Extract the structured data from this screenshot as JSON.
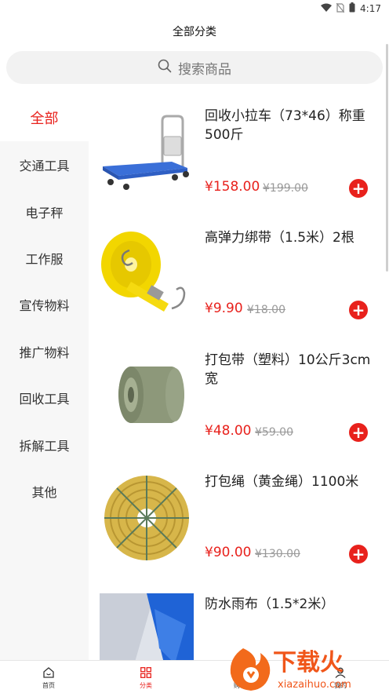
{
  "status_bar": {
    "time": "4:17"
  },
  "header": {
    "title": "全部分类"
  },
  "search": {
    "placeholder": "搜索商品"
  },
  "sidebar": {
    "items": [
      {
        "label": "全部",
        "active": true
      },
      {
        "label": "交通工具"
      },
      {
        "label": "电子秤"
      },
      {
        "label": "工作服"
      },
      {
        "label": "宣传物料"
      },
      {
        "label": "推广物料"
      },
      {
        "label": "回收工具"
      },
      {
        "label": "拆解工具"
      },
      {
        "label": "其他"
      }
    ]
  },
  "products": [
    {
      "title": "回收小拉车（73*46）称重500斤",
      "price": "¥158.00",
      "old_price": "¥199.00",
      "image": "hand-truck"
    },
    {
      "title": "高弹力绑带（1.5米）2根",
      "price": "¥9.90",
      "old_price": "¥18.00",
      "image": "ratchet-strap"
    },
    {
      "title": "打包带（塑料）10公斤3cm宽",
      "price": "¥48.00",
      "old_price": "¥59.00",
      "image": "packing-strap-roll"
    },
    {
      "title": "打包绳（黄金绳）1100米",
      "price": "¥90.00",
      "old_price": "¥130.00",
      "image": "gold-rope-coil"
    },
    {
      "title": "防水雨布（1.5*2米）",
      "price": "",
      "old_price": "",
      "image": "tarp"
    }
  ],
  "tabbar": {
    "tabs": [
      {
        "label": "首页",
        "icon": "home-icon"
      },
      {
        "label": "分类",
        "icon": "grid-icon",
        "active": true
      },
      {
        "label": "购物车",
        "icon": "cart-icon"
      },
      {
        "label": "我的",
        "icon": "user-icon"
      }
    ]
  },
  "watermark": {
    "text": "下载火",
    "url": "xiazaihuo.com"
  },
  "colors": {
    "accent": "#e8211c",
    "sidebar_bg": "#f7f7f7",
    "search_bg": "#f2f2f2"
  }
}
